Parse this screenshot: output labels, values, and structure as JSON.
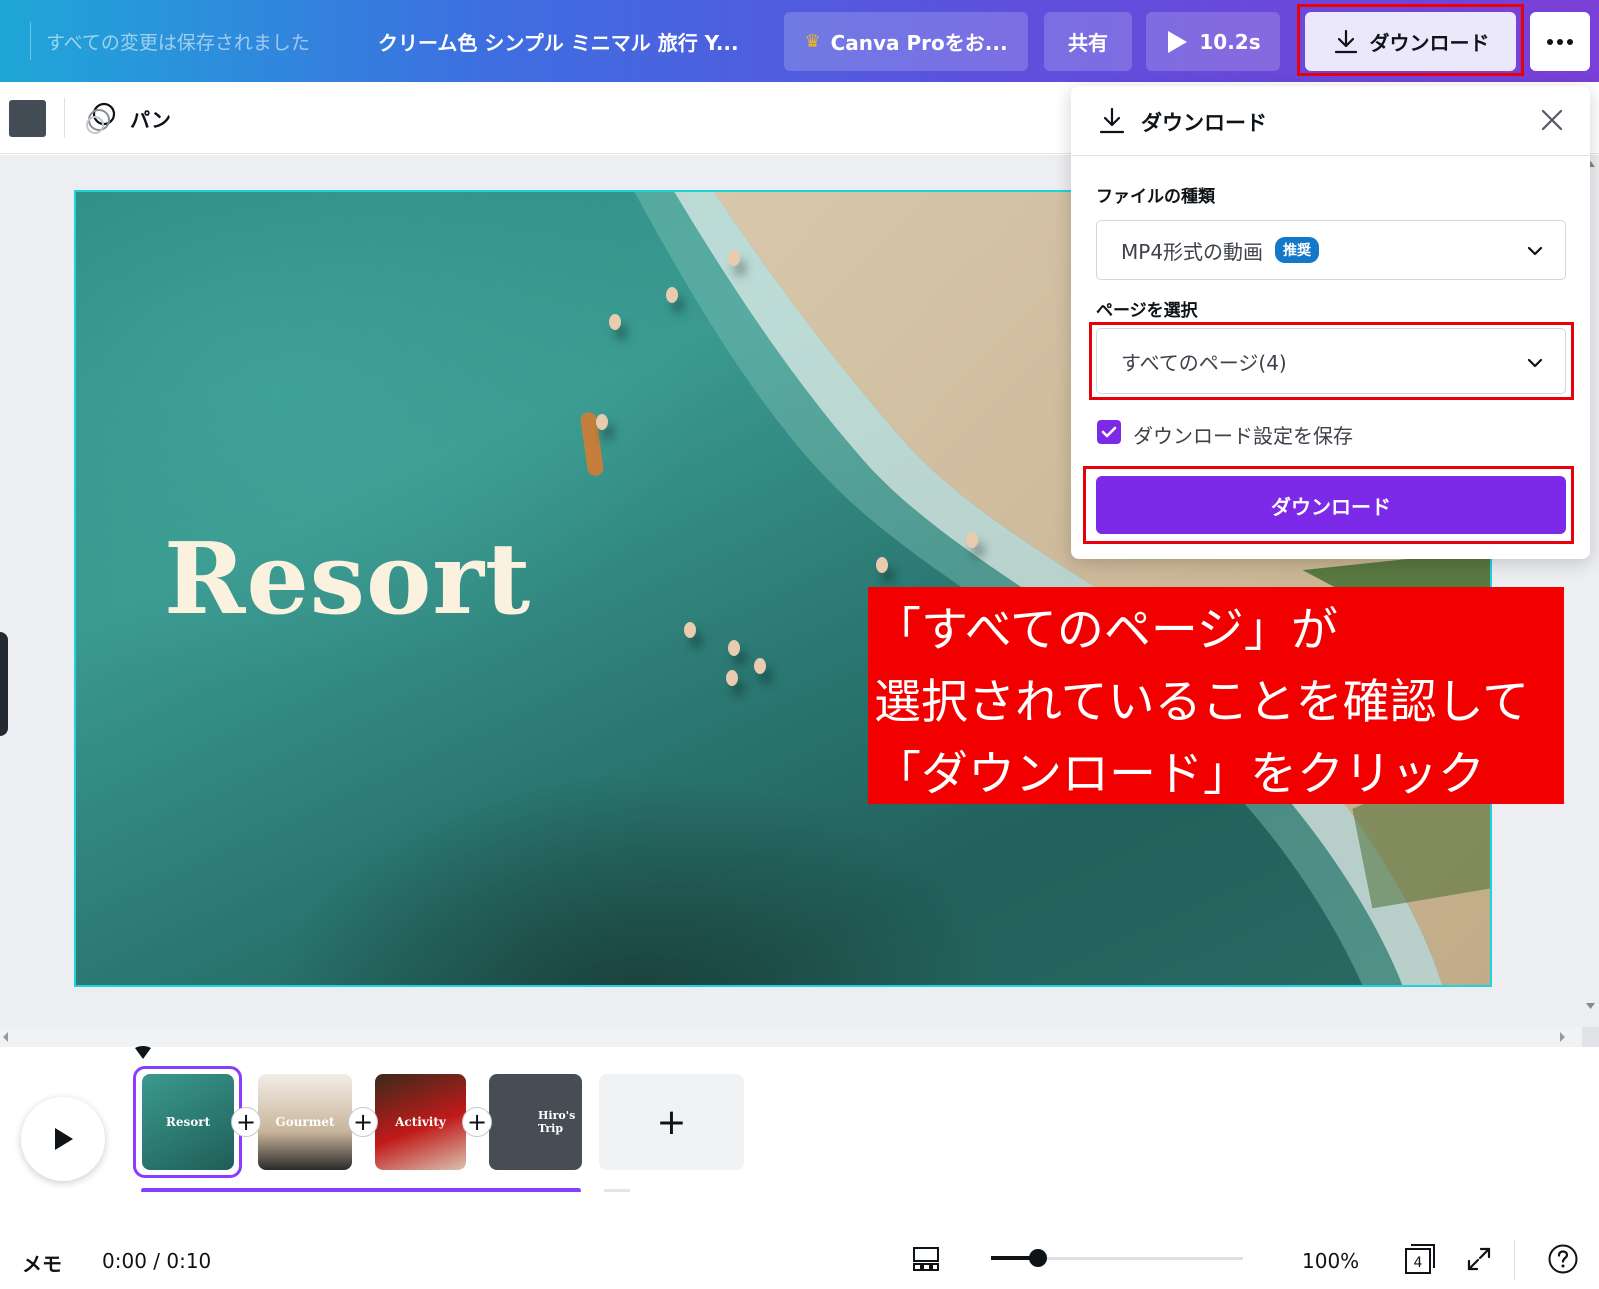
{
  "header": {
    "saved_status": "すべての変更は保存されました",
    "doc_title": "クリーム色 シンプル ミニマル 旅行 Y...",
    "pro_button": "Canva Proをお...",
    "share_button": "共有",
    "play_duration": "10.2s",
    "download_button": "ダウンロード"
  },
  "toolbar": {
    "pan_label": "パン"
  },
  "canvas": {
    "title_text": "Resort"
  },
  "download_panel": {
    "title": "ダウンロード",
    "file_type_label": "ファイルの種類",
    "file_type_value": "MP4形式の動画",
    "file_type_badge": "推奨",
    "page_select_label": "ページを選択",
    "page_select_value": "すべてのページ(4)",
    "save_settings_label": "ダウンロード設定を保存",
    "save_settings_checked": true,
    "submit_label": "ダウンロード"
  },
  "callout": {
    "line1": "「すべてのページ」が",
    "line2": "選択されていることを確認して",
    "line3": "「ダウンロード」をクリック"
  },
  "timeline": {
    "thumbnails": [
      {
        "label": "Resort"
      },
      {
        "label": "Gourmet"
      },
      {
        "label": "Activity"
      },
      {
        "label": "Hiro's Trip"
      }
    ],
    "add_page": "+"
  },
  "footer": {
    "memo_label": "メモ",
    "timecode": "0:00 / 0:10",
    "zoom": "100%",
    "page_count": "4"
  },
  "colors": {
    "accent": "#7d2ae8",
    "annotation_red": "#f20000",
    "canvas_border": "#1dd3df"
  }
}
